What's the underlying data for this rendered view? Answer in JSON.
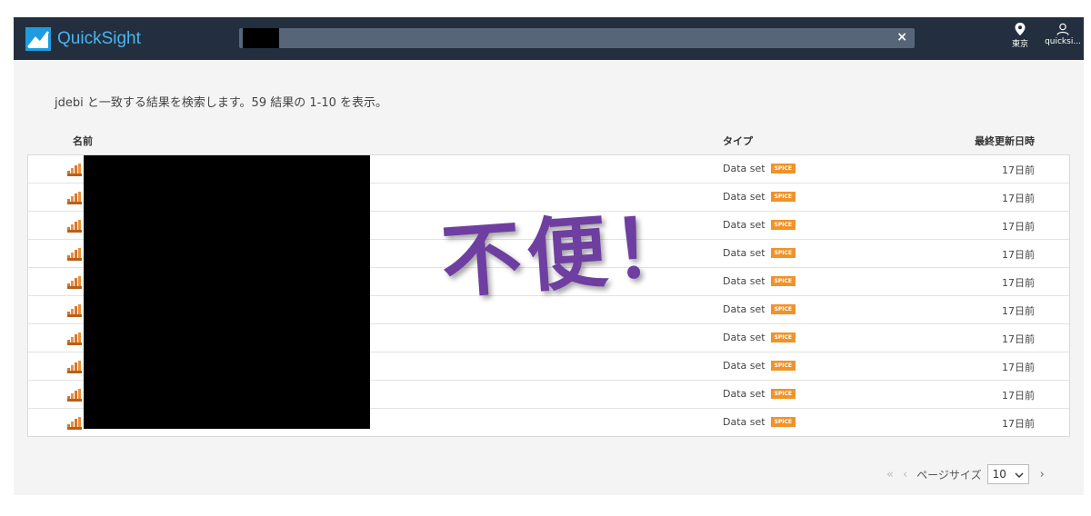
{
  "header": {
    "app_name": "QuickSight",
    "search_value": "",
    "clear_symbol": "×",
    "region_label": "東京",
    "user_label": "quicksi..."
  },
  "colors": {
    "header_bg": "#232f3e",
    "brand": "#1f9ce0",
    "spice_badge": "#f0932a",
    "overlay": "#6f3ea1"
  },
  "summary": "jdebi と一致する結果を検索します。59 結果の 1-10 を表示。",
  "table": {
    "columns": [
      "名前",
      "タイプ",
      "最終更新日時"
    ],
    "rows": [
      {
        "type": "Data set",
        "badge": "SPICE",
        "updated": "17日前",
        "icon": "dataset-icon"
      },
      {
        "type": "Data set",
        "badge": "SPICE",
        "updated": "17日前",
        "icon": "dataset-icon"
      },
      {
        "type": "Data set",
        "badge": "SPICE",
        "updated": "17日前",
        "icon": "dataset-icon"
      },
      {
        "type": "Data set",
        "badge": "SPICE",
        "updated": "17日前",
        "icon": "dataset-icon"
      },
      {
        "type": "Data set",
        "badge": "SPICE",
        "updated": "17日前",
        "icon": "dataset-icon"
      },
      {
        "type": "Data set",
        "badge": "SPICE",
        "updated": "17日前",
        "icon": "dataset-icon"
      },
      {
        "type": "Data set",
        "badge": "SPICE",
        "updated": "17日前",
        "icon": "dataset-icon"
      },
      {
        "type": "Data set",
        "badge": "SPICE",
        "updated": "17日前",
        "icon": "dataset-icon"
      },
      {
        "type": "Data set",
        "badge": "SPICE",
        "updated": "17日前",
        "icon": "dataset-icon"
      },
      {
        "type": "Data set",
        "badge": "SPICE",
        "updated": "17日前",
        "icon": "dataset-icon"
      }
    ]
  },
  "overlay_text": "不便！",
  "pagination": {
    "first_symbol": "«",
    "prev_symbol": "‹",
    "page_size_label": "ページサイズ",
    "page_size_value": "10",
    "next_symbol": "›"
  }
}
